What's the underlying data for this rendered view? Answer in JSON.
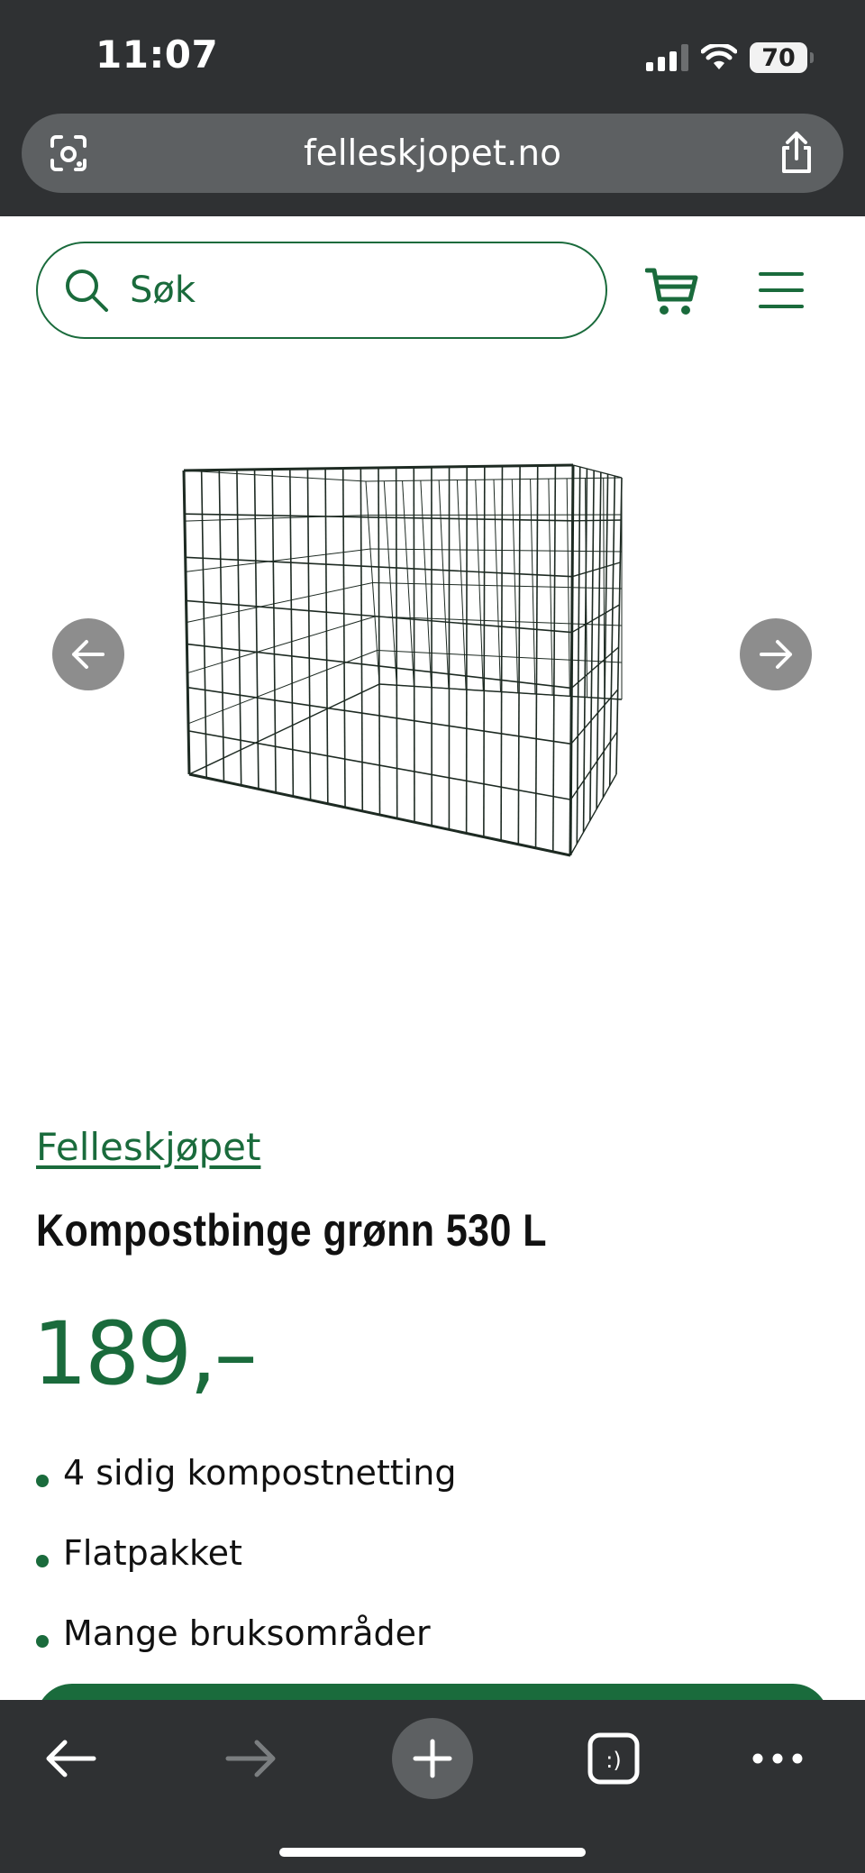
{
  "status_bar": {
    "time": "11:07",
    "battery": "70"
  },
  "browser": {
    "url": "felleskjopet.no",
    "icons": {
      "lens": "camera-scan-icon",
      "share": "share-icon",
      "back": "arrow-left-icon",
      "forward": "arrow-right-icon",
      "new_tab": "plus-icon",
      "tabs": "tab-switcher-icon",
      "more": "more-dots-icon"
    }
  },
  "header": {
    "search_label": "Søk",
    "icons": {
      "search": "search-icon",
      "cart": "cart-icon",
      "menu": "hamburger-menu-icon"
    }
  },
  "gallery": {
    "image": "compost-bin-wire-mesh-image",
    "prev_icon": "arrow-left-icon",
    "next_icon": "arrow-right-icon"
  },
  "product": {
    "brand": "Felleskjøpet",
    "title": "Kompostbinge grønn 530 L",
    "price": "189,–",
    "features": [
      "4 sidig kompostnetting",
      "Flatpakket",
      "Mange bruksområder"
    ]
  },
  "colors": {
    "brand_green": "#1a6b3c",
    "chrome_dark": "#2f3133",
    "chrome_pill": "#5d6062"
  }
}
